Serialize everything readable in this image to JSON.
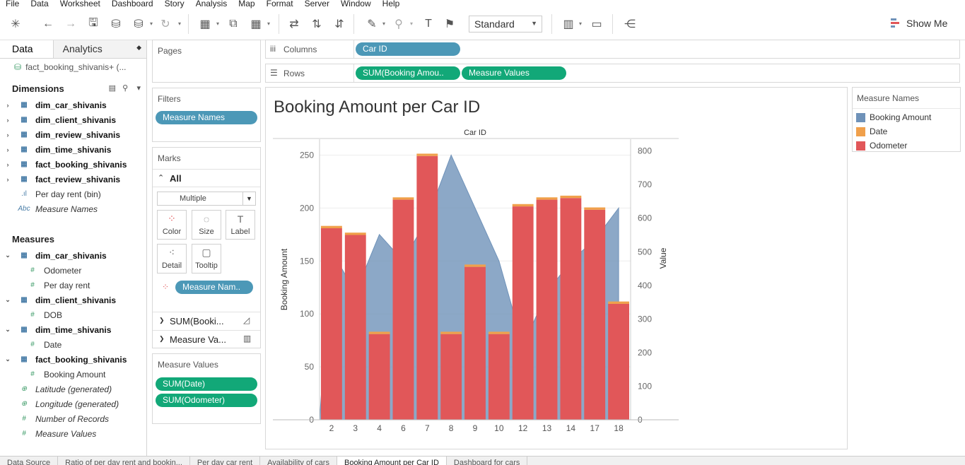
{
  "menu": [
    "File",
    "Data",
    "Worksheet",
    "Dashboard",
    "Story",
    "Analysis",
    "Map",
    "Format",
    "Server",
    "Window",
    "Help"
  ],
  "toolbar": {
    "fit": "Standard",
    "show_me": "Show Me"
  },
  "data_pane": {
    "tab_data": "Data",
    "tab_analytics": "Analytics",
    "datasource": "fact_booking_shivanis+ (...",
    "dimensions_title": "Dimensions",
    "dimensions": [
      {
        "label": "dim_car_shivanis",
        "kind": "table"
      },
      {
        "label": "dim_client_shivanis",
        "kind": "table"
      },
      {
        "label": "dim_review_shivanis",
        "kind": "table"
      },
      {
        "label": "dim_time_shivanis",
        "kind": "table"
      },
      {
        "label": "fact_booking_shivanis",
        "kind": "table"
      },
      {
        "label": "fact_review_shivanis",
        "kind": "table"
      },
      {
        "label": "Per day rent (bin)",
        "kind": "bin"
      },
      {
        "label": "Measure Names",
        "kind": "abc"
      }
    ],
    "measures_title": "Measures",
    "measures": [
      {
        "label": "dim_car_shivanis",
        "kind": "table"
      },
      {
        "label": "Odometer",
        "kind": "measure"
      },
      {
        "label": "Per day rent",
        "kind": "measure"
      },
      {
        "label": "dim_client_shivanis",
        "kind": "table"
      },
      {
        "label": "DOB",
        "kind": "measure"
      },
      {
        "label": "dim_time_shivanis",
        "kind": "table"
      },
      {
        "label": "Date",
        "kind": "measure"
      },
      {
        "label": "fact_booking_shivanis",
        "kind": "table"
      },
      {
        "label": "Booking Amount",
        "kind": "measure"
      },
      {
        "label": "Latitude (generated)",
        "kind": "geo"
      },
      {
        "label": "Longitude (generated)",
        "kind": "geo"
      },
      {
        "label": "Number of Records",
        "kind": "count"
      },
      {
        "label": "Measure Values",
        "kind": "count"
      }
    ]
  },
  "shelves": {
    "pages": "Pages",
    "columns_label": "Columns",
    "columns_pill": "Car ID",
    "rows_label": "Rows",
    "rows_pills": [
      "SUM(Booking Amou..",
      "Measure Values"
    ],
    "filters": "Filters",
    "filter_pill": "Measure Names"
  },
  "marks": {
    "title": "Marks",
    "all": "All",
    "mark_type": "Multiple",
    "buttons": [
      "Color",
      "Size",
      "Label",
      "Detail",
      "Tooltip"
    ],
    "color_pill": "Measure Nam..",
    "sub1": "SUM(Booki...",
    "sub2": "Measure Va..."
  },
  "measure_values_card": {
    "title": "Measure Values",
    "pills": [
      "SUM(Date)",
      "SUM(Odometer)"
    ]
  },
  "worksheet": {
    "title": "Booking Amount per Car ID"
  },
  "legend": {
    "title": "Measure Names",
    "items": [
      {
        "label": "Booking Amount",
        "color": "#6f92b9"
      },
      {
        "label": "Date",
        "color": "#f0a04b"
      },
      {
        "label": "Odometer",
        "color": "#e15759"
      }
    ]
  },
  "chart_data": {
    "type": "bar",
    "title": "Booking Amount per Car ID",
    "xlabel": "Car ID",
    "ylabel": "Booking Amount",
    "y2label": "Value",
    "categories": [
      "2",
      "3",
      "4",
      "6",
      "7",
      "8",
      "9",
      "10",
      "12",
      "13",
      "14",
      "17",
      "18"
    ],
    "ylim": [
      0,
      265
    ],
    "y_ticks": [
      0,
      50,
      100,
      150,
      200,
      250
    ],
    "y2lim": [
      0,
      835
    ],
    "y2_ticks": [
      0,
      100,
      200,
      300,
      400,
      500,
      600,
      700,
      800
    ],
    "series": [
      {
        "name": "Booking Amount",
        "color": "#6f92b9",
        "mark": "area",
        "axis": "left",
        "values": [
          160,
          120,
          175,
          150,
          190,
          250,
          200,
          150,
          70,
          120,
          150,
          170,
          200
        ]
      },
      {
        "name": "Odometer",
        "color": "#e15759",
        "mark": "bar",
        "axis": "right",
        "values": [
          570,
          550,
          255,
          655,
          785,
          255,
          455,
          255,
          635,
          655,
          660,
          625,
          345
        ]
      },
      {
        "name": "Date",
        "color": "#f0a04b",
        "mark": "bar-stack",
        "axis": "right",
        "values": [
          7,
          7,
          7,
          7,
          7,
          7,
          7,
          7,
          7,
          7,
          7,
          7,
          7
        ]
      }
    ]
  },
  "bottom_tabs": [
    "Data Source",
    "Ratio of per day rent and bookin...",
    "Per day car rent",
    "Availability of cars",
    "Booking Amount per Car ID",
    "Dashboard for cars"
  ]
}
